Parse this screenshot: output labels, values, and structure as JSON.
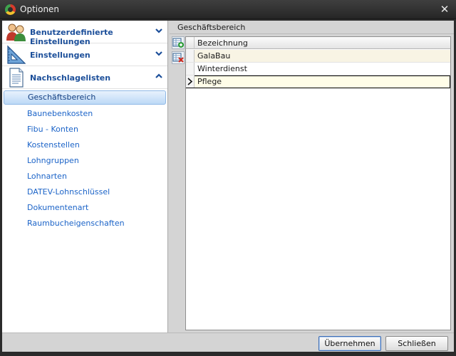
{
  "window": {
    "title": "Optionen"
  },
  "nav": {
    "headers": [
      {
        "label": "Benutzerdefinierte Einstellungen",
        "icon": "users-icon",
        "expanded": false
      },
      {
        "label": "Einstellungen",
        "icon": "ruler-triangle-icon",
        "expanded": false
      },
      {
        "label": "Nachschlagelisten",
        "icon": "document-icon",
        "expanded": true
      }
    ],
    "items": [
      "Geschäftsbereich",
      "Baunebenkosten",
      "Fibu - Konten",
      "Kostenstellen",
      "Lohngruppen",
      "Lohnarten",
      "DATEV-Lohnschlüssel",
      "Dokumentenart",
      "Raumbucheigenschaften"
    ],
    "active_index": 0
  },
  "panel": {
    "title": "Geschäftsbereich",
    "column": "Bezeichnung",
    "rows": [
      "GalaBau",
      "Winterdienst",
      "Pflege"
    ],
    "selected_row": 2
  },
  "footer": {
    "apply_label": "Übernehmen",
    "close_label": "Schließen"
  },
  "colors": {
    "nav_link": "#1c64c8",
    "nav_header": "#1c4f9a",
    "row_alt": "#f8f4e4",
    "active_item": "#bcd9f6"
  }
}
